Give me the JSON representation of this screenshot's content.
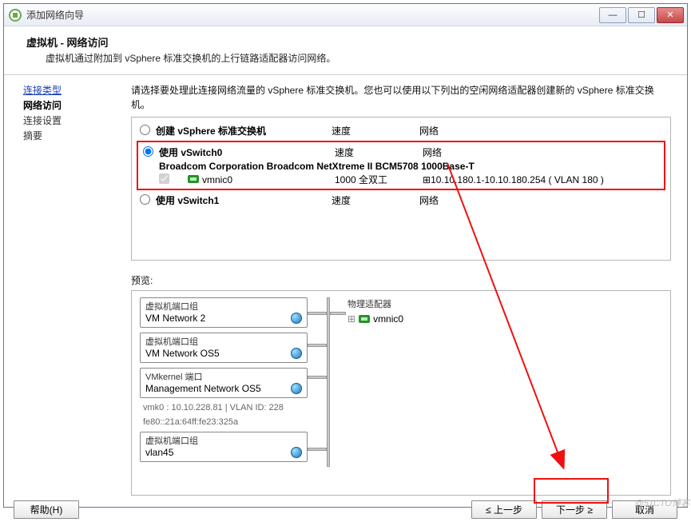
{
  "titlebar": {
    "title": "添加网络向导"
  },
  "header": {
    "title": "虚拟机 - 网络访问",
    "subtitle": "虚拟机通过附加到 vSphere 标准交换机的上行链路适配器访问网络。"
  },
  "sidebar": {
    "items": [
      {
        "label": "连接类型",
        "kind": "link"
      },
      {
        "label": "网络访问",
        "kind": "active"
      },
      {
        "label": "连接设置",
        "kind": "plain"
      },
      {
        "label": "摘要",
        "kind": "plain"
      }
    ]
  },
  "main": {
    "prompt": "请选择要处理此连接网络流量的 vSphere 标准交换机。您也可以使用以下列出的空闲网络适配器创建新的 vSphere 标准交换机。",
    "cols": {
      "speed": "速度",
      "network": "网络"
    },
    "options": [
      {
        "radio": false,
        "label": "创建 vSphere 标准交换机",
        "speed": "速度",
        "network": "网络",
        "nics": []
      },
      {
        "radio": true,
        "label": "使用 vSwitch0",
        "speed": "速度",
        "network": "网络",
        "highlight": true,
        "desc": "Broadcom Corporation Broadcom NetXtreme II BCM5708 1000Base-T",
        "nics": [
          {
            "checked": true,
            "name": "vmnic0",
            "speed": "1000 全双工",
            "network": "10.10.180.1-10.10.180.254 ( VLAN 180 )"
          }
        ]
      },
      {
        "radio": false,
        "label": "使用 vSwitch1",
        "speed": "速度",
        "network": "网络",
        "nics": []
      }
    ],
    "preview_label": "预览:",
    "preview": {
      "left_label": "虚拟机端口组",
      "vmkernel_label": "VMkernel 端口",
      "phys_label": "物理适配器",
      "phys": [
        {
          "name": "vmnic0"
        }
      ],
      "groups": [
        {
          "type": "vm",
          "name": "VM Network 2"
        },
        {
          "type": "vm",
          "name": "VM Network OS5"
        },
        {
          "type": "vmk",
          "name": "Management Network OS5",
          "meta1": "vmk0 : 10.10.228.81 | VLAN ID: 228",
          "meta2": "fe80::21a:64ff:fe23:325a"
        },
        {
          "type": "vm",
          "name": "vlan45"
        }
      ]
    }
  },
  "footer": {
    "help": "帮助(H)",
    "back": "≤ 上一步",
    "next": "下一步 ≥",
    "cancel": "取消"
  },
  "watermark": "@51CTO博客"
}
